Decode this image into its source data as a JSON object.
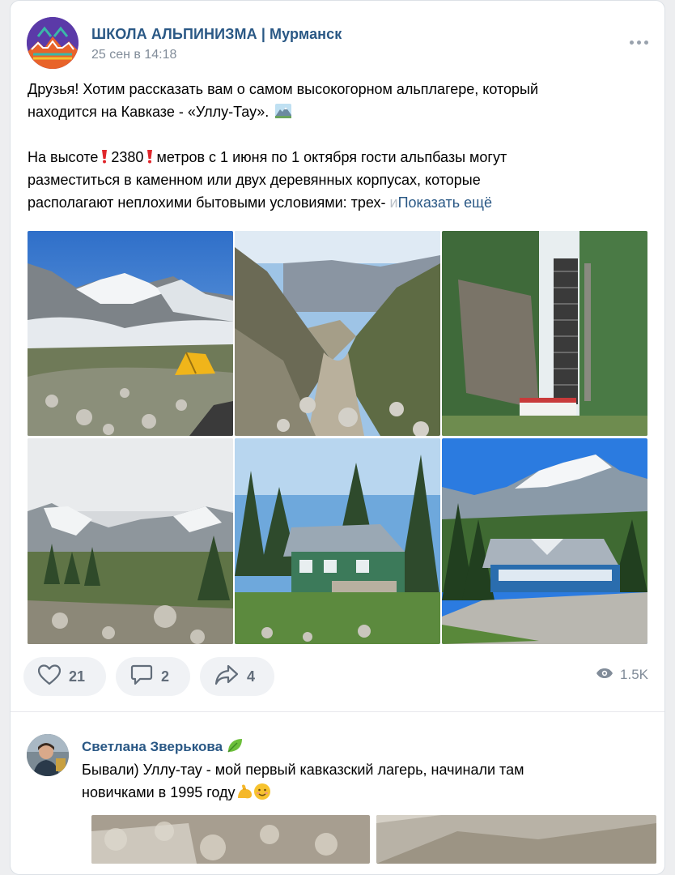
{
  "post": {
    "author": "ШКОЛА АЛЬПИНИЗМА | Мурманск",
    "date": "25 сен в 14:18",
    "text_line1": "Друзья! Хотим рассказать вам о самом высокогорном альплагере, который",
    "text_line2": "находится на Кавказе - «Уллу-Тау».",
    "text_line3a": "На высоте",
    "text_line3b": "2380",
    "text_line3c": "метров с 1 июня по 1 октября гости альпбазы могут",
    "text_line4": "разместиться в каменном или двух деревянных корпусах, которые",
    "text_line5": "располагают неплохими бытовыми условиями: трех-",
    "text_fade": "и",
    "show_more": "Показать ещё",
    "photos": [
      "alpine-meadow-tent",
      "mountain-valley",
      "funicular-rail",
      "cloudy-valley",
      "wooden-house",
      "camp-building"
    ]
  },
  "actions": {
    "likes": "21",
    "comments": "2",
    "shares": "4",
    "views": "1.5K"
  },
  "comment": {
    "author": "Светлана Зверькова",
    "line1": "Бывали) Уллу-тау - мой первый кавказский лагерь, начинали там",
    "line2": "новичками в 1995 году"
  },
  "colors": {
    "link": "#2a5885",
    "muted": "#818c99",
    "pill_bg": "#f0f2f5",
    "icon": "#626d7a"
  }
}
